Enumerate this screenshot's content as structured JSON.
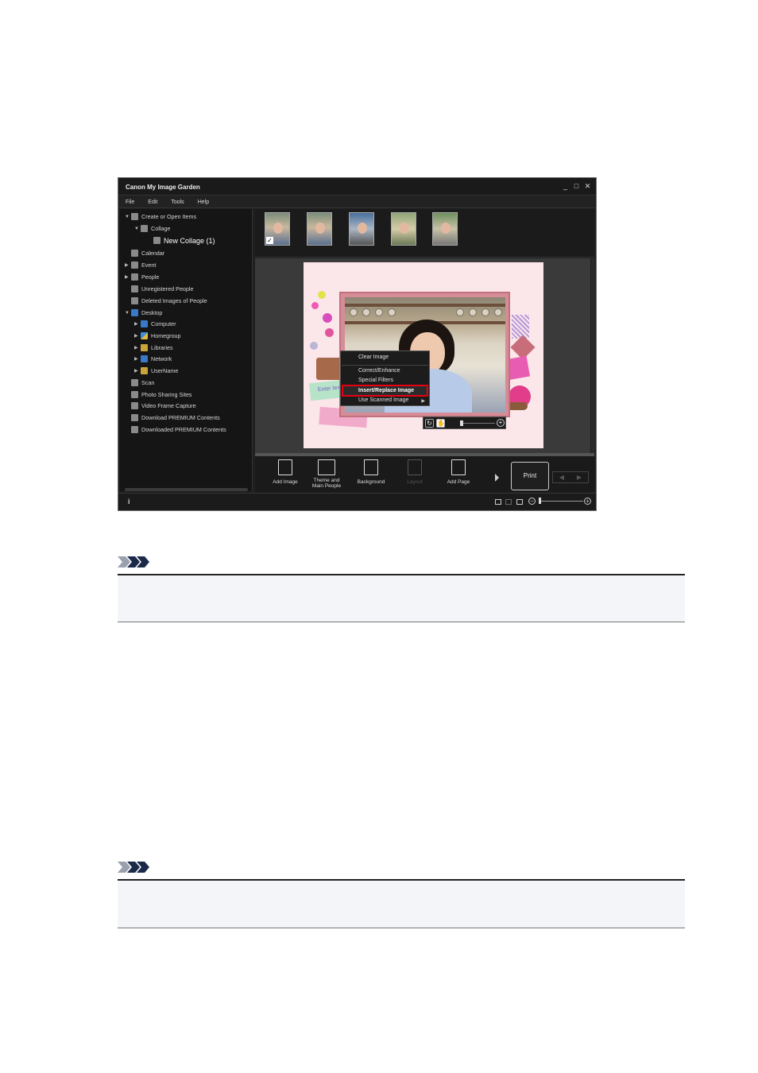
{
  "window": {
    "title": "Canon My Image Garden",
    "controls": [
      "_",
      "□",
      "✕"
    ]
  },
  "menu": [
    "File",
    "Edit",
    "Tools",
    "Help"
  ],
  "sidebar": {
    "items": [
      {
        "label": "Create or Open Items",
        "icon": "create-icon"
      },
      {
        "label": "Collage",
        "icon": "collage-icon"
      },
      {
        "label": "New Collage (1)",
        "icon": "collage-file-icon"
      },
      {
        "label": "Calendar",
        "icon": "calendar-icon"
      },
      {
        "label": "Event",
        "icon": "event-icon"
      },
      {
        "label": "People",
        "icon": "people-icon"
      },
      {
        "label": "Unregistered People",
        "icon": "unregistered-people-icon"
      },
      {
        "label": "Deleted Images of People",
        "icon": "deleted-people-icon"
      },
      {
        "label": "Desktop",
        "icon": "desktop-icon"
      },
      {
        "label": "Computer",
        "icon": "computer-icon"
      },
      {
        "label": "Homegroup",
        "icon": "homegroup-icon"
      },
      {
        "label": "Libraries",
        "icon": "libraries-icon"
      },
      {
        "label": "Network",
        "icon": "network-icon"
      },
      {
        "label": "UserName",
        "icon": "user-folder-icon"
      },
      {
        "label": "Scan",
        "icon": "scan-icon"
      },
      {
        "label": "Photo Sharing Sites",
        "icon": "photo-sharing-icon"
      },
      {
        "label": "Video Frame Capture",
        "icon": "video-icon"
      },
      {
        "label": "Download PREMIUM Contents",
        "icon": "download-icon"
      },
      {
        "label": "Downloaded PREMIUM Contents",
        "icon": "folder-icon"
      }
    ]
  },
  "context_menu": {
    "items": [
      "Clear Image",
      "Correct/Enhance",
      "Special Filters",
      "Insert/Replace Image",
      "Use Scanned Image"
    ],
    "highlighted": "Insert/Replace Image"
  },
  "collage": {
    "text_box": "Enter tex"
  },
  "toolbar": {
    "add_image": "Add Image",
    "theme_line1": "Theme and",
    "theme_line2": "Main People",
    "background": "Background",
    "layout": "Layout",
    "add_page": "Add Page",
    "print": "Print"
  },
  "statusbar": {
    "info": "i"
  },
  "colors": {
    "highlight_box": "#e60012",
    "app_background": "#1f1f1f",
    "note_background": "#f4f5f9"
  }
}
